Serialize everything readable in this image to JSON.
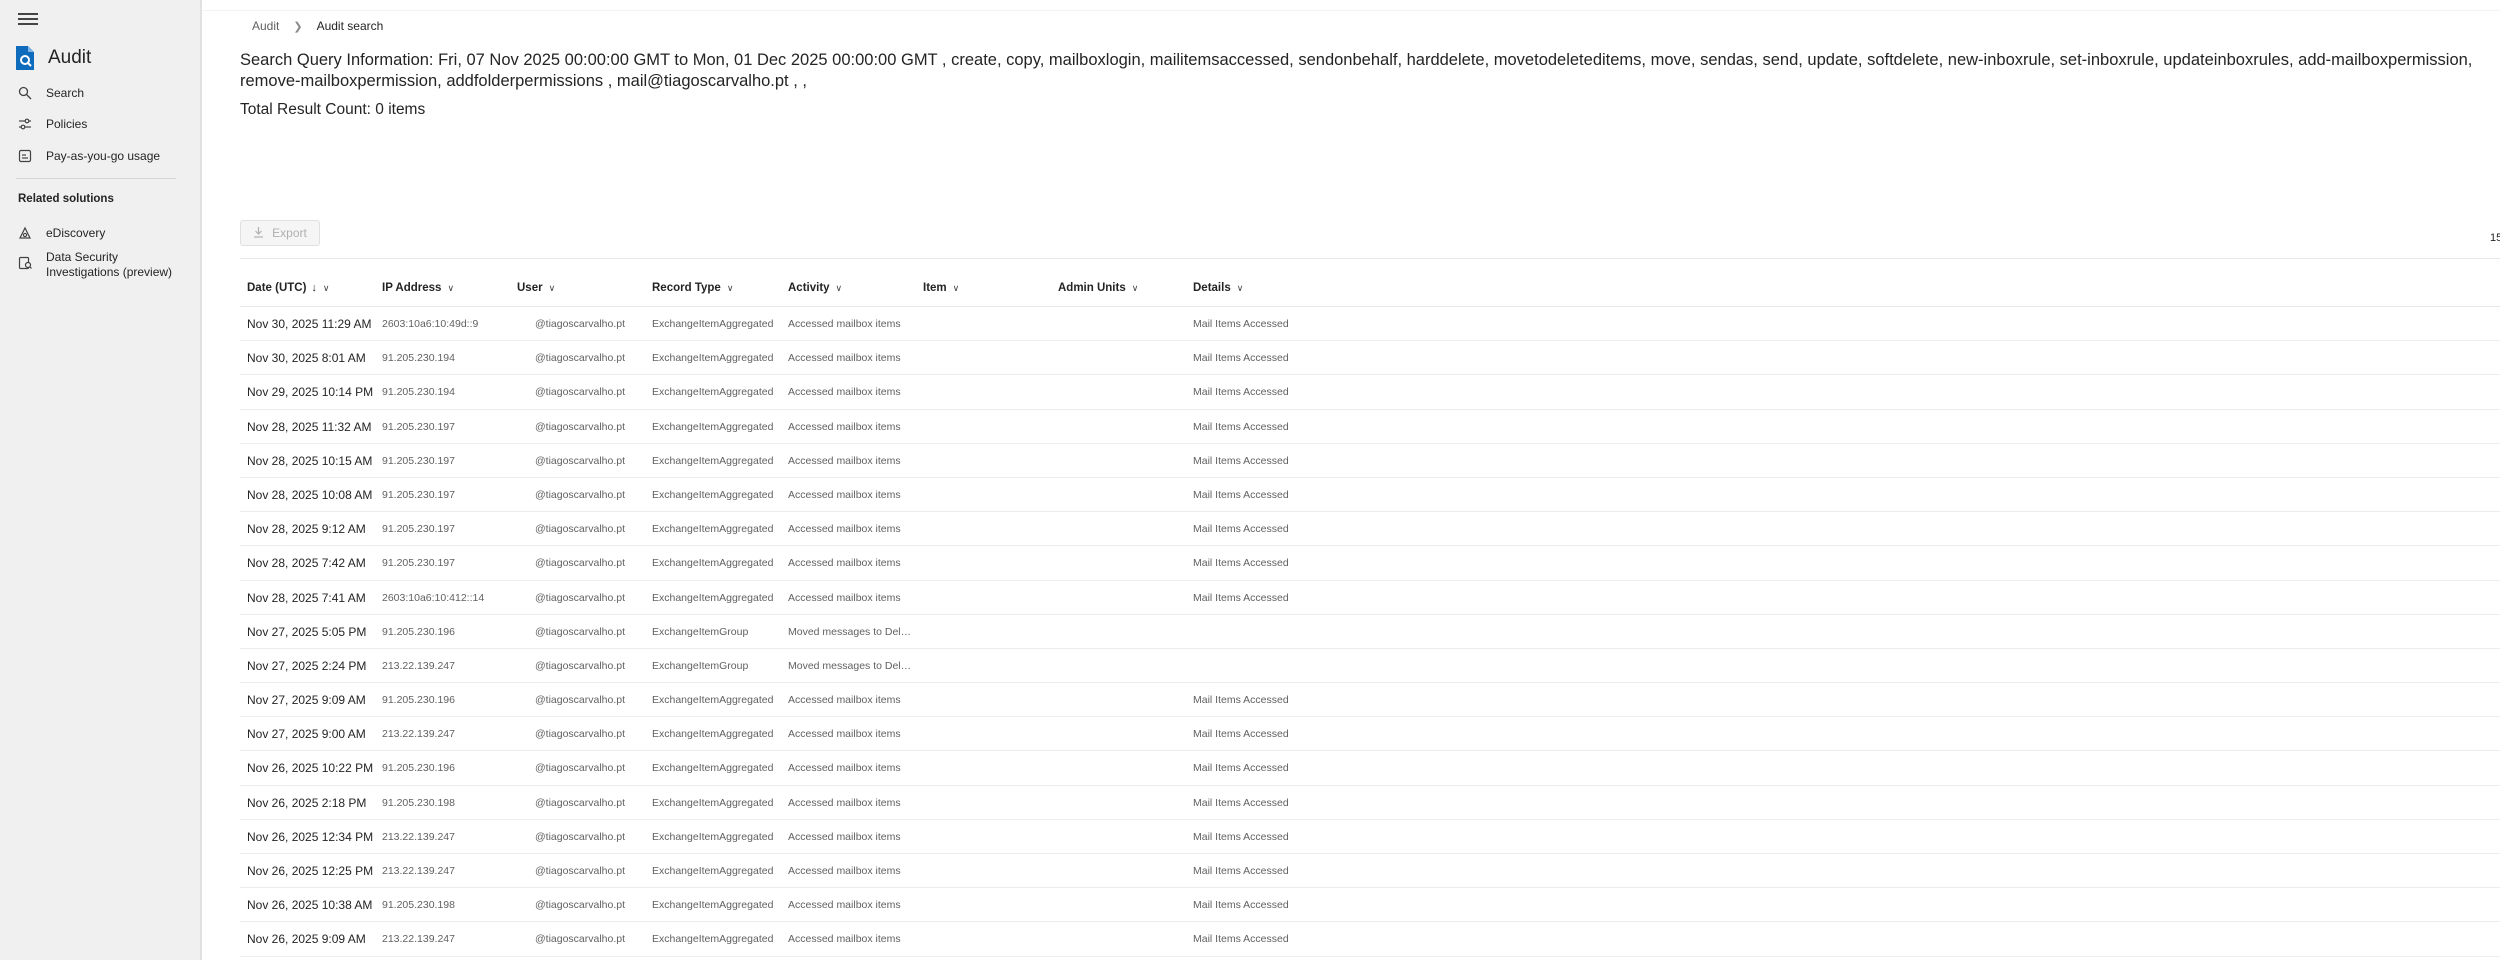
{
  "nav": {
    "app_title": "Audit",
    "items": [
      {
        "label": "Search",
        "icon": "search-icon"
      },
      {
        "label": "Policies",
        "icon": "policies-icon"
      },
      {
        "label": "Pay-as-you-go usage",
        "icon": "usage-icon"
      }
    ],
    "related_title": "Related solutions",
    "related": [
      {
        "label": "eDiscovery",
        "icon": "ediscovery-icon"
      },
      {
        "label_line1": "Data Security",
        "label_line2": "Investigations (preview)",
        "icon": "investigations-icon"
      }
    ]
  },
  "breadcrumb": {
    "root": "Audit",
    "current": "Audit search"
  },
  "query_text": "Search Query Information: Fri, 07 Nov 2025 00:00:00 GMT to Mon, 01 Dec 2025 00:00:00 GMT , create, copy, mailboxlogin, mailitemsaccessed, sendonbehalf, harddelete, movetodeleteditems, move, sendas, send, update, softdelete, new-inboxrule, set-inboxrule, updateinboxrules, add-mailboxpermission, remove-mailboxpermission, addfolderpermissions , mail@tiagoscarvalho.pt , ,",
  "result_count": "Total Result Count: 0 items",
  "export_label": "Export",
  "right_edge_text": "15",
  "columns": {
    "date": "Date (UTC)",
    "ip": "IP Address",
    "user": "User",
    "record_type": "Record Type",
    "activity": "Activity",
    "item": "Item",
    "admin_units": "Admin Units",
    "details": "Details"
  },
  "rows": [
    {
      "date": "Nov 30, 2025 11:29 AM",
      "ip": "2603:10a6:10:49d::9",
      "user": "@tiagoscarvalho.pt",
      "record_type": "ExchangeItemAggregated",
      "activity": "Accessed mailbox items",
      "item": "",
      "admin_units": "",
      "details": "Mail Items Accessed"
    },
    {
      "date": "Nov 30, 2025 8:01 AM",
      "ip": "91.205.230.194",
      "user": "@tiagoscarvalho.pt",
      "record_type": "ExchangeItemAggregated",
      "activity": "Accessed mailbox items",
      "item": "",
      "admin_units": "",
      "details": "Mail Items Accessed"
    },
    {
      "date": "Nov 29, 2025 10:14 PM",
      "ip": "91.205.230.194",
      "user": "@tiagoscarvalho.pt",
      "record_type": "ExchangeItemAggregated",
      "activity": "Accessed mailbox items",
      "item": "",
      "admin_units": "",
      "details": "Mail Items Accessed"
    },
    {
      "date": "Nov 28, 2025 11:32 AM",
      "ip": "91.205.230.197",
      "user": "@tiagoscarvalho.pt",
      "record_type": "ExchangeItemAggregated",
      "activity": "Accessed mailbox items",
      "item": "",
      "admin_units": "",
      "details": "Mail Items Accessed"
    },
    {
      "date": "Nov 28, 2025 10:15 AM",
      "ip": "91.205.230.197",
      "user": "@tiagoscarvalho.pt",
      "record_type": "ExchangeItemAggregated",
      "activity": "Accessed mailbox items",
      "item": "",
      "admin_units": "",
      "details": "Mail Items Accessed"
    },
    {
      "date": "Nov 28, 2025 10:08 AM",
      "ip": "91.205.230.197",
      "user": "@tiagoscarvalho.pt",
      "record_type": "ExchangeItemAggregated",
      "activity": "Accessed mailbox items",
      "item": "",
      "admin_units": "",
      "details": "Mail Items Accessed"
    },
    {
      "date": "Nov 28, 2025 9:12 AM",
      "ip": "91.205.230.197",
      "user": "@tiagoscarvalho.pt",
      "record_type": "ExchangeItemAggregated",
      "activity": "Accessed mailbox items",
      "item": "",
      "admin_units": "",
      "details": "Mail Items Accessed"
    },
    {
      "date": "Nov 28, 2025 7:42 AM",
      "ip": "91.205.230.197",
      "user": "@tiagoscarvalho.pt",
      "record_type": "ExchangeItemAggregated",
      "activity": "Accessed mailbox items",
      "item": "",
      "admin_units": "",
      "details": "Mail Items Accessed"
    },
    {
      "date": "Nov 28, 2025 7:41 AM",
      "ip": "2603:10a6:10:412::14",
      "user": "@tiagoscarvalho.pt",
      "record_type": "ExchangeItemAggregated",
      "activity": "Accessed mailbox items",
      "item": "",
      "admin_units": "",
      "details": "Mail Items Accessed"
    },
    {
      "date": "Nov 27, 2025 5:05 PM",
      "ip": "91.205.230.196",
      "user": "@tiagoscarvalho.pt",
      "record_type": "ExchangeItemGroup",
      "activity": "Moved messages to Deleted Items folder",
      "item": "",
      "admin_units": "",
      "details": ""
    },
    {
      "date": "Nov 27, 2025 2:24 PM",
      "ip": "213.22.139.247",
      "user": "@tiagoscarvalho.pt",
      "record_type": "ExchangeItemGroup",
      "activity": "Moved messages to Deleted Items folder",
      "item": "",
      "admin_units": "",
      "details": ""
    },
    {
      "date": "Nov 27, 2025 9:09 AM",
      "ip": "91.205.230.196",
      "user": "@tiagoscarvalho.pt",
      "record_type": "ExchangeItemAggregated",
      "activity": "Accessed mailbox items",
      "item": "",
      "admin_units": "",
      "details": "Mail Items Accessed"
    },
    {
      "date": "Nov 27, 2025 9:00 AM",
      "ip": "213.22.139.247",
      "user": "@tiagoscarvalho.pt",
      "record_type": "ExchangeItemAggregated",
      "activity": "Accessed mailbox items",
      "item": "",
      "admin_units": "",
      "details": "Mail Items Accessed"
    },
    {
      "date": "Nov 26, 2025 10:22 PM",
      "ip": "91.205.230.196",
      "user": "@tiagoscarvalho.pt",
      "record_type": "ExchangeItemAggregated",
      "activity": "Accessed mailbox items",
      "item": "",
      "admin_units": "",
      "details": "Mail Items Accessed"
    },
    {
      "date": "Nov 26, 2025 2:18 PM",
      "ip": "91.205.230.198",
      "user": "@tiagoscarvalho.pt",
      "record_type": "ExchangeItemAggregated",
      "activity": "Accessed mailbox items",
      "item": "",
      "admin_units": "",
      "details": "Mail Items Accessed"
    },
    {
      "date": "Nov 26, 2025 12:34 PM",
      "ip": "213.22.139.247",
      "user": "@tiagoscarvalho.pt",
      "record_type": "ExchangeItemAggregated",
      "activity": "Accessed mailbox items",
      "item": "",
      "admin_units": "",
      "details": "Mail Items Accessed"
    },
    {
      "date": "Nov 26, 2025 12:25 PM",
      "ip": "213.22.139.247",
      "user": "@tiagoscarvalho.pt",
      "record_type": "ExchangeItemAggregated",
      "activity": "Accessed mailbox items",
      "item": "",
      "admin_units": "",
      "details": "Mail Items Accessed"
    },
    {
      "date": "Nov 26, 2025 10:38 AM",
      "ip": "91.205.230.198",
      "user": "@tiagoscarvalho.pt",
      "record_type": "ExchangeItemAggregated",
      "activity": "Accessed mailbox items",
      "item": "",
      "admin_units": "",
      "details": "Mail Items Accessed"
    },
    {
      "date": "Nov 26, 2025 9:09 AM",
      "ip": "213.22.139.247",
      "user": "@tiagoscarvalho.pt",
      "record_type": "ExchangeItemAggregated",
      "activity": "Accessed mailbox items",
      "item": "",
      "admin_units": "",
      "details": "Mail Items Accessed"
    }
  ],
  "colors": {
    "brand_blue": "#0f6cbd",
    "nav_bg": "#f0f0f0"
  }
}
